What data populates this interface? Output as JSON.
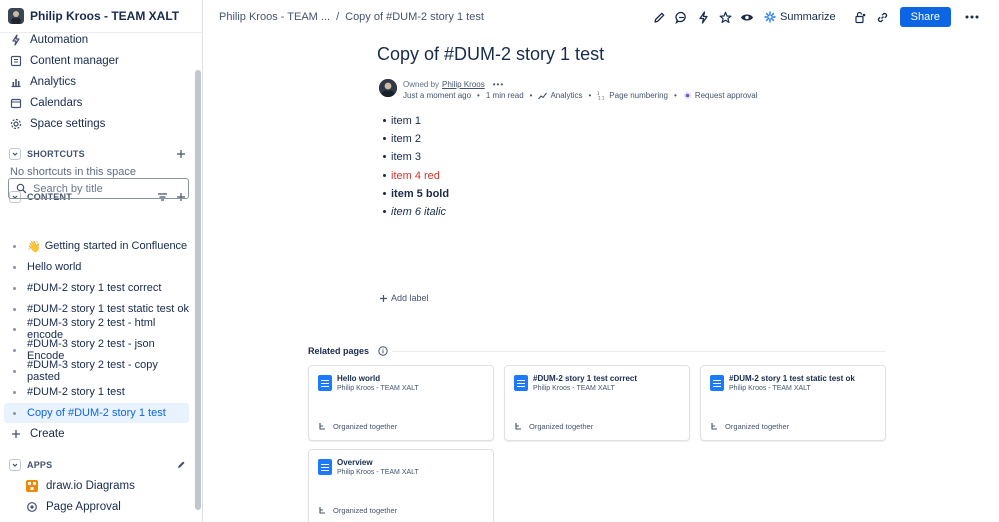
{
  "sidebar": {
    "space_name": "Philip Kroos - TEAM XALT",
    "nav": [
      {
        "label": "Automation",
        "icon": "lightning-icon"
      },
      {
        "label": "Content manager",
        "icon": "content-manager-icon"
      },
      {
        "label": "Analytics",
        "icon": "analytics-icon"
      },
      {
        "label": "Calendars",
        "icon": "calendar-icon"
      },
      {
        "label": "Space settings",
        "icon": "gear-icon"
      }
    ],
    "shortcuts": {
      "title": "SHORTCUTS",
      "empty_text": "No shortcuts in this space"
    },
    "content": {
      "title": "CONTENT",
      "search_placeholder": "Search by title",
      "pages": [
        {
          "label": "Getting started in Confluence",
          "emoji": "👋"
        },
        {
          "label": "Hello world"
        },
        {
          "label": "#DUM-2 story 1 test correct"
        },
        {
          "label": "#DUM-2 story 1 test static test ok"
        },
        {
          "label": "#DUM-3 story 2 test - html encode"
        },
        {
          "label": "#DUM-3 story 2 test - json Encode"
        },
        {
          "label": "#DUM-3 story 2 test - copy pasted"
        },
        {
          "label": "#DUM-2 story 1 test"
        },
        {
          "label": "Copy of #DUM-2 story 1 test",
          "active": true
        }
      ],
      "create_label": "Create"
    },
    "apps": {
      "title": "APPS",
      "items": [
        {
          "label": "draw.io Diagrams"
        },
        {
          "label": "Page Approval"
        }
      ]
    }
  },
  "topbar": {
    "breadcrumb_space": "Philip Kroos - TEAM ...",
    "breadcrumb_separator": "/",
    "breadcrumb_page": "Copy of #DUM-2 story 1 test",
    "summarize_label": "Summarize",
    "share_label": "Share"
  },
  "page": {
    "title": "Copy of #DUM-2 story 1 test",
    "owned_by_prefix": "Owned by",
    "owner": "Philip Kroos",
    "more": "•••",
    "updated": "Just a moment ago",
    "read_time": "1 min read",
    "analytics": "Analytics",
    "page_numbering": "Page numbering",
    "request_approval": "Request approval",
    "items": [
      {
        "text": "item 1",
        "style": "normal"
      },
      {
        "text": "item 2",
        "style": "normal"
      },
      {
        "text": "item 3",
        "style": "normal"
      },
      {
        "text": "item 4 red",
        "style": "red"
      },
      {
        "text": "item 5 bold",
        "style": "bold"
      },
      {
        "text": "item 6 italic",
        "style": "italic"
      }
    ],
    "add_label": "Add label",
    "red_color": "#c9372c"
  },
  "related": {
    "title": "Related pages",
    "cards": [
      {
        "title": "Hello world",
        "space": "Philip Kroos - TEAM XALT",
        "footer": "Organized together"
      },
      {
        "title": "#DUM-2 story 1 test correct",
        "space": "Philip Kroos - TEAM XALT",
        "footer": "Organized together"
      },
      {
        "title": "#DUM-2 story 1 test static test ok",
        "space": "Philip Kroos - TEAM XALT",
        "footer": "Organized together"
      },
      {
        "title": "Overview",
        "space": "Philip Kroos - TEAM XALT",
        "footer": "Organized together"
      }
    ]
  },
  "colors": {
    "accent": "#0c66e4",
    "active_bg": "#e9f2ff",
    "text": "#172b4d"
  }
}
